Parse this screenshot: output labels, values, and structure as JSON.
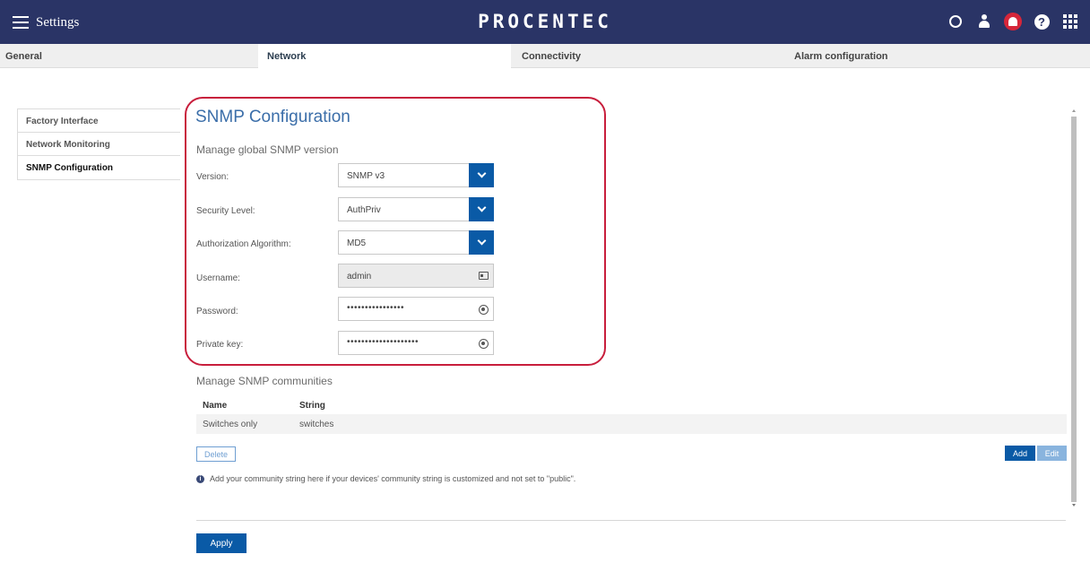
{
  "header": {
    "menu_label": "Settings",
    "brand": "PROCENTEC",
    "icons": [
      "refresh-ring-icon",
      "user-icon",
      "bell-icon",
      "help-icon",
      "apps-grid-icon"
    ],
    "accent_color": "#2a3466",
    "alert_color": "#d6263a"
  },
  "tabs": [
    {
      "label": "General"
    },
    {
      "label": "Network"
    },
    {
      "label": "Connectivity"
    },
    {
      "label": "Alarm configuration"
    }
  ],
  "sidebar": {
    "items": [
      {
        "label": "Factory Interface"
      },
      {
        "label": "Network Monitoring"
      },
      {
        "label": "SNMP Configuration"
      }
    ]
  },
  "snmp": {
    "title": "SNMP Configuration",
    "global_heading": "Manage global SNMP version",
    "version": {
      "label": "Version:",
      "value": "SNMP v3"
    },
    "security_level": {
      "label": "Security Level:",
      "value": "AuthPriv"
    },
    "auth_algorithm": {
      "label": "Authorization Algorithm:",
      "value": "MD5"
    },
    "username": {
      "label": "Username:",
      "value": "admin"
    },
    "password": {
      "label": "Password:",
      "value": "••••••••••••••••"
    },
    "private_key": {
      "label": "Private key:",
      "value": "••••••••••••••••••••"
    }
  },
  "communities": {
    "heading": "Manage SNMP communities",
    "columns": {
      "name": "Name",
      "string": "String"
    },
    "rows": [
      {
        "name": "Switches only",
        "string": "switches"
      }
    ],
    "delete_label": "Delete",
    "add_label": "Add",
    "edit_label": "Edit",
    "info_text": "Add your community string here if your devices' community string is customized and not set to \"public\"."
  },
  "footer": {
    "apply_label": "Apply",
    "primary_color": "#0a5aa6"
  }
}
